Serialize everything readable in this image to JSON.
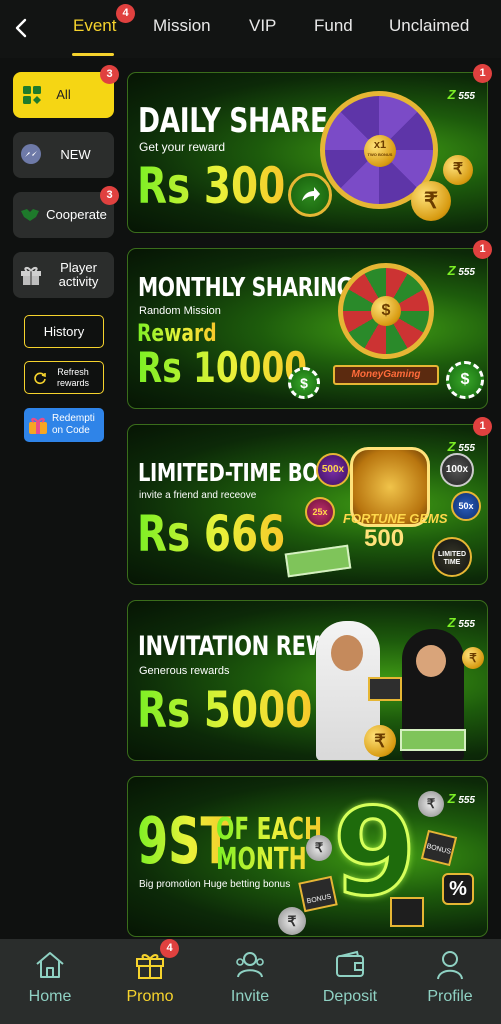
{
  "nav": {
    "tabs": [
      {
        "label": "Event",
        "badge": "4"
      },
      {
        "label": "Mission"
      },
      {
        "label": "VIP"
      },
      {
        "label": "Fund"
      },
      {
        "label": "Unclaimed"
      }
    ]
  },
  "sidebar": {
    "items": [
      {
        "label": "All",
        "badge": "3"
      },
      {
        "label": "NEW"
      },
      {
        "label": "Cooperate",
        "badge": "3"
      },
      {
        "label": "Player activity"
      }
    ],
    "history_label": "History",
    "refresh_label": "Refresh rewards",
    "redeem_label": "Redempti on Code"
  },
  "banners": [
    {
      "title": "DAILY SHARE",
      "subtitle": "Get your reward",
      "amount": "Rs 300",
      "badge": "1",
      "art": [
        "x1",
        "TWO BONUS"
      ]
    },
    {
      "title": "MONTHLY SHARING",
      "subtitle": "Random Mission",
      "reward_label": "Reward",
      "amount": "Rs 10000",
      "badge": "1",
      "art": [
        "MoneyGaming"
      ]
    },
    {
      "title": "LIMITED-TIME BONUS",
      "subtitle": "invite a friend and receove",
      "amount": "Rs 666",
      "badge": "1",
      "art": [
        "500x",
        "100x",
        "25x",
        "50x",
        "FORTUNE GEMS",
        "500",
        "LIMITED TIME"
      ]
    },
    {
      "title": "INVITATION REWARD",
      "subtitle": "Generous rewards",
      "amount": "Rs 5000"
    },
    {
      "title_big": "9ST",
      "title_small": "OF EACH MONTH",
      "subtitle": "Big promotion Huge betting bonus",
      "art": [
        "9",
        "BONUS",
        "BONUS",
        "%"
      ]
    }
  ],
  "brand": "555",
  "bottom_nav": [
    {
      "label": "Home"
    },
    {
      "label": "Promo",
      "badge": "4"
    },
    {
      "label": "Invite"
    },
    {
      "label": "Deposit"
    },
    {
      "label": "Profile"
    }
  ],
  "colors": {
    "accent": "#f6d32d",
    "badge": "#e0413f",
    "nav_inactive": "#8fd1c3",
    "banner_green": "#3f9a14"
  }
}
